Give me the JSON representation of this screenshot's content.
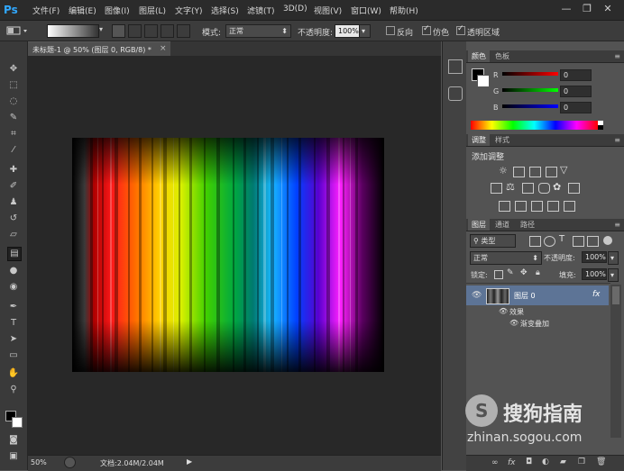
{
  "app": {
    "logo": "Ps"
  },
  "menu": [
    "文件(F)",
    "编辑(E)",
    "图像(I)",
    "图层(L)",
    "文字(Y)",
    "选择(S)",
    "滤镜(T)",
    "3D(D)",
    "视图(V)",
    "窗口(W)",
    "帮助(H)"
  ],
  "window_controls": {
    "minimize": "—",
    "restore": "❐",
    "close": "✕"
  },
  "options": {
    "mode_label": "模式:",
    "mode_value": "正常",
    "opacity_label": "不透明度:",
    "opacity_value": "100%",
    "reverse_label": "反向",
    "dither_label": "仿色",
    "transparency_label": "透明区域",
    "reverse_checked": false,
    "dither_checked": true,
    "transparency_checked": true
  },
  "document": {
    "tab_title": "未标题-1 @ 50% (图层 0, RGB/8) *",
    "close": "×"
  },
  "status": {
    "zoom": "50%",
    "doc_info": "文档:2.04M/2.04M"
  },
  "panels": {
    "color": {
      "tabs": [
        "颜色",
        "色板"
      ],
      "channels": [
        {
          "label": "R",
          "value": "0"
        },
        {
          "label": "G",
          "value": "0"
        },
        {
          "label": "B",
          "value": "0"
        }
      ]
    },
    "adjustments": {
      "tabs": [
        "调整",
        "样式"
      ],
      "title": "添加调整"
    },
    "layers": {
      "tabs": [
        "图层",
        "通道",
        "路径"
      ],
      "filter_kind": "类型",
      "blend_mode": "正常",
      "opacity_label": "不透明度:",
      "opacity_value": "100%",
      "lock_label": "锁定:",
      "fill_label": "填充:",
      "fill_value": "100%",
      "layer_name": "图层 0",
      "fx": "fx",
      "effects_label": "效果",
      "effect_name": "渐变叠加"
    }
  },
  "watermark": {
    "brand": "搜狗指南",
    "url": "zhinan.sogou.com"
  },
  "colors": {
    "accent": "#31a8ff",
    "menubar": "#2b2b2b",
    "canvas_bg": "#282828",
    "panel_bg": "#535353",
    "selected_layer": "#5d7496"
  }
}
